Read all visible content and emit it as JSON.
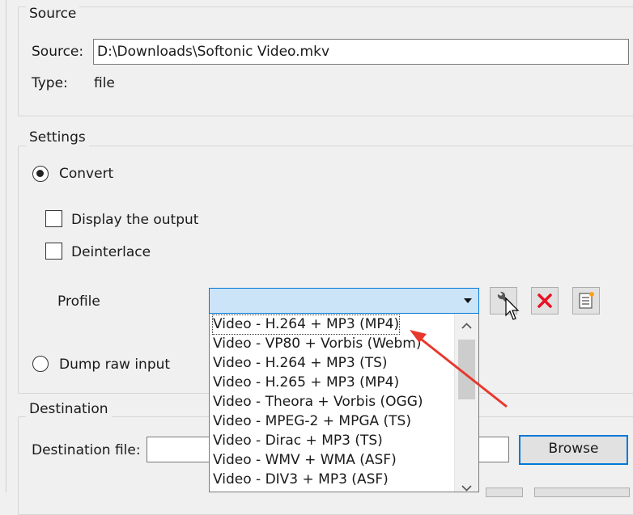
{
  "source_group": {
    "title": "Source",
    "source_label": "Source:",
    "source_value": "D:\\Downloads\\Softonic Video.mkv",
    "type_label": "Type:",
    "type_value": "file"
  },
  "settings_group": {
    "title": "Settings",
    "convert_label": "Convert",
    "convert_selected": true,
    "display_output_label": "Display the output",
    "display_output_checked": false,
    "deinterlace_label": "Deinterlace",
    "deinterlace_checked": false,
    "profile_label": "Profile",
    "profile_value": "",
    "dump_raw_label": "Dump raw input",
    "dump_raw_selected": false,
    "profile_options": [
      "Video - H.264 + MP3 (MP4)",
      "Video - VP80 + Vorbis (Webm)",
      "Video - H.264 + MP3 (TS)",
      "Video - H.265 + MP3 (MP4)",
      "Video - Theora + Vorbis (OGG)",
      "Video - MPEG-2 + MPGA (TS)",
      "Video - Dirac + MP3 (TS)",
      "Video - WMV + WMA (ASF)",
      "Video - DIV3 + MP3 (ASF)"
    ]
  },
  "destination_group": {
    "title": "Destination",
    "dest_file_label": "Destination file:",
    "dest_file_value": "",
    "browse_label": "Browse"
  },
  "colors": {
    "annotation_arrow": "#e8372c",
    "delete_icon": "#e81123",
    "focus_blue": "#0078d7"
  },
  "icons": {
    "edit_profile": "wrench-icon",
    "delete_profile": "red-x-icon",
    "new_profile": "list-icon"
  }
}
